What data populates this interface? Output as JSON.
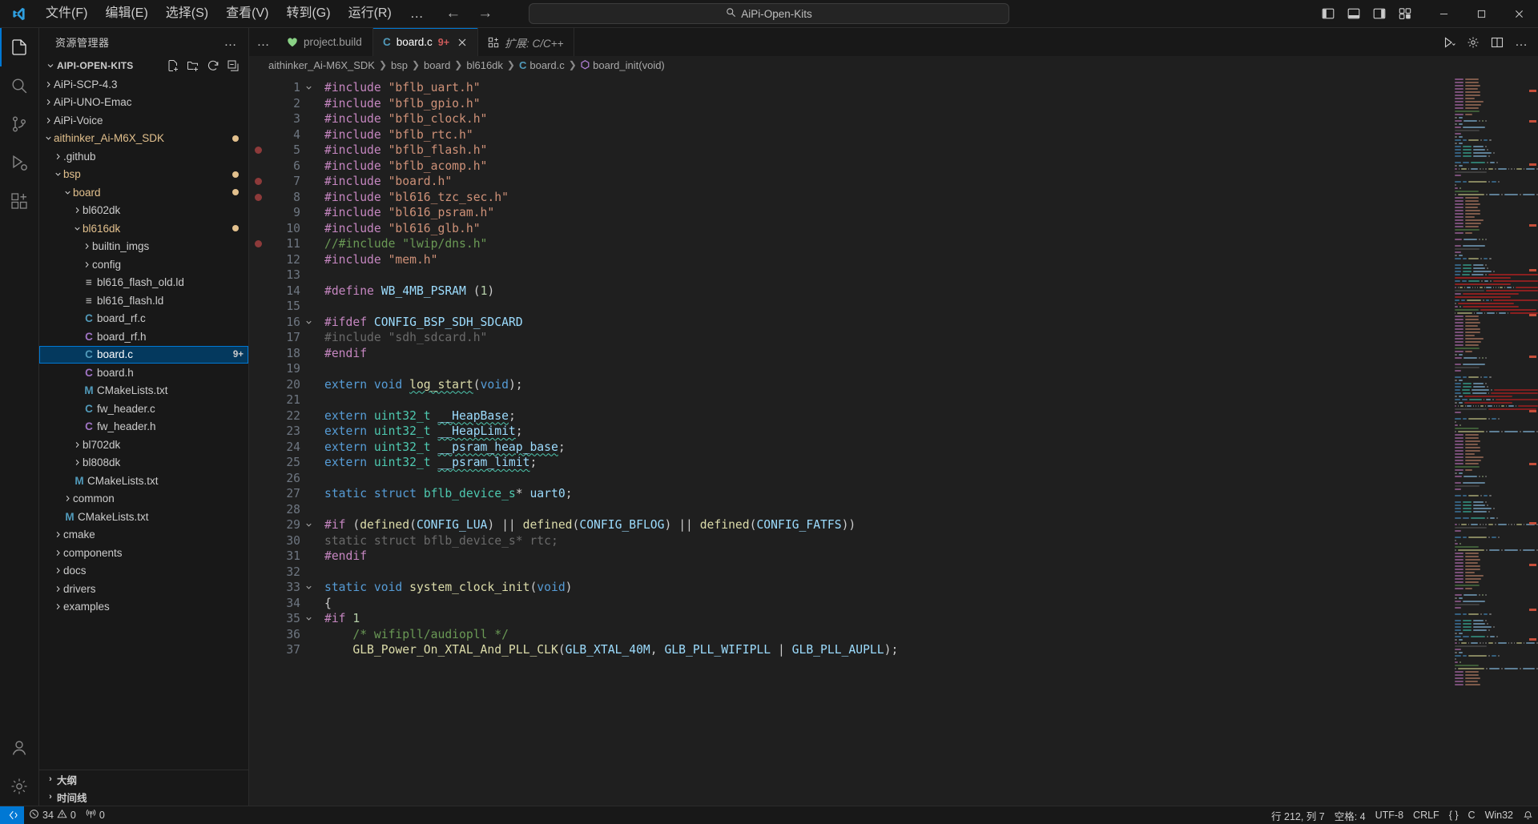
{
  "titlebar": {
    "menu": [
      "文件(F)",
      "编辑(E)",
      "选择(S)",
      "查看(V)",
      "转到(G)",
      "运行(R)"
    ],
    "more_label": "…",
    "back_label": "←",
    "forward_label": "→",
    "search_value": "AiPi-Open-Kits"
  },
  "sidebar": {
    "header_title": "资源管理器",
    "more_label": "…",
    "root_label": "AIPI-OPEN-KITS",
    "sections": [
      "大纲",
      "时间线"
    ],
    "tree": [
      {
        "name": "AiPi-SCP-4.3",
        "indent": 1,
        "type": "folder",
        "expanded": false,
        "modified": false
      },
      {
        "name": "AiPi-UNO-Emac",
        "indent": 1,
        "type": "folder",
        "expanded": false,
        "modified": false
      },
      {
        "name": "AiPi-Voice",
        "indent": 1,
        "type": "folder",
        "expanded": false,
        "modified": false
      },
      {
        "name": "aithinker_Ai-M6X_SDK",
        "indent": 1,
        "type": "folder",
        "expanded": true,
        "modified": true
      },
      {
        "name": ".github",
        "indent": 2,
        "type": "folder",
        "expanded": false,
        "modified": false
      },
      {
        "name": "bsp",
        "indent": 2,
        "type": "folder",
        "expanded": true,
        "modified": true
      },
      {
        "name": "board",
        "indent": 3,
        "type": "folder",
        "expanded": true,
        "modified": true
      },
      {
        "name": "bl602dk",
        "indent": 4,
        "type": "folder",
        "expanded": false,
        "modified": false
      },
      {
        "name": "bl616dk",
        "indent": 4,
        "type": "folder",
        "expanded": true,
        "modified": true
      },
      {
        "name": "builtin_imgs",
        "indent": 5,
        "type": "folder",
        "expanded": false,
        "modified": false
      },
      {
        "name": "config",
        "indent": 5,
        "type": "folder",
        "expanded": false,
        "modified": false
      },
      {
        "name": "bl616_flash_old.ld",
        "indent": 5,
        "type": "ld",
        "icon": "≡",
        "color": "#cccccc"
      },
      {
        "name": "bl616_flash.ld",
        "indent": 5,
        "type": "ld",
        "icon": "≡",
        "color": "#cccccc"
      },
      {
        "name": "board_rf.c",
        "indent": 5,
        "type": "c",
        "icon": "C",
        "color": "#519aba"
      },
      {
        "name": "board_rf.h",
        "indent": 5,
        "type": "h",
        "icon": "C",
        "color": "#a074c4"
      },
      {
        "name": "board.c",
        "indent": 5,
        "type": "c",
        "icon": "C",
        "color": "#519aba",
        "selected": true,
        "badge": "9+"
      },
      {
        "name": "board.h",
        "indent": 5,
        "type": "h",
        "icon": "C",
        "color": "#a074c4"
      },
      {
        "name": "CMakeLists.txt",
        "indent": 5,
        "type": "cmake",
        "icon": "M",
        "color": "#519aba"
      },
      {
        "name": "fw_header.c",
        "indent": 5,
        "type": "c",
        "icon": "C",
        "color": "#519aba"
      },
      {
        "name": "fw_header.h",
        "indent": 5,
        "type": "h",
        "icon": "C",
        "color": "#a074c4"
      },
      {
        "name": "bl702dk",
        "indent": 4,
        "type": "folder",
        "expanded": false,
        "modified": false
      },
      {
        "name": "bl808dk",
        "indent": 4,
        "type": "folder",
        "expanded": false,
        "modified": false
      },
      {
        "name": "CMakeLists.txt",
        "indent": 4,
        "type": "cmake",
        "icon": "M",
        "color": "#519aba"
      },
      {
        "name": "common",
        "indent": 3,
        "type": "folder",
        "expanded": false,
        "modified": false
      },
      {
        "name": "CMakeLists.txt",
        "indent": 3,
        "type": "cmake",
        "icon": "M",
        "color": "#519aba"
      },
      {
        "name": "cmake",
        "indent": 2,
        "type": "folder",
        "expanded": false,
        "modified": false
      },
      {
        "name": "components",
        "indent": 2,
        "type": "folder",
        "expanded": false,
        "modified": false
      },
      {
        "name": "docs",
        "indent": 2,
        "type": "folder",
        "expanded": false,
        "modified": false
      },
      {
        "name": "drivers",
        "indent": 2,
        "type": "folder",
        "expanded": false,
        "modified": false
      },
      {
        "name": "examples",
        "indent": 2,
        "type": "folder",
        "expanded": false,
        "modified": false
      }
    ]
  },
  "tabs": [
    {
      "label": "project.build",
      "icon": "heart",
      "icon_color": "#89d185",
      "active": false,
      "badge": "",
      "preview": false
    },
    {
      "label": "board.c",
      "icon": "C",
      "icon_color": "#519aba",
      "active": true,
      "badge": "9+",
      "preview": false,
      "closable": true
    },
    {
      "label": "扩展: C/C++",
      "icon": "extensions",
      "icon_color": "#cccccc",
      "active": false,
      "badge": "",
      "preview": true
    }
  ],
  "breadcrumb": [
    {
      "label": "aithinker_Ai-M6X_SDK"
    },
    {
      "label": "bsp"
    },
    {
      "label": "board"
    },
    {
      "label": "bl616dk"
    },
    {
      "label": "board.c",
      "icon": "C",
      "icon_color": "#519aba"
    },
    {
      "label": "board_init(void)",
      "icon": "symbol",
      "icon_color": "#b180d7"
    }
  ],
  "editor": {
    "first_line": 1,
    "lines": [
      {
        "n": 1,
        "fold": "v",
        "bp": false,
        "tokens": [
          [
            "#include ",
            "c-pre"
          ],
          [
            "\"bflb_uart.h\"",
            "c-str"
          ]
        ]
      },
      {
        "n": 2,
        "fold": "",
        "bp": false,
        "tokens": [
          [
            "#include ",
            "c-pre"
          ],
          [
            "\"bflb_gpio.h\"",
            "c-str"
          ]
        ]
      },
      {
        "n": 3,
        "fold": "",
        "bp": false,
        "tokens": [
          [
            "#include ",
            "c-pre"
          ],
          [
            "\"bflb_clock.h\"",
            "c-str"
          ]
        ]
      },
      {
        "n": 4,
        "fold": "",
        "bp": false,
        "tokens": [
          [
            "#include ",
            "c-pre"
          ],
          [
            "\"bflb_rtc.h\"",
            "c-str"
          ]
        ]
      },
      {
        "n": 5,
        "fold": "",
        "bp": true,
        "tokens": [
          [
            "#include ",
            "c-pre"
          ],
          [
            "\"bflb_flash.h\"",
            "c-str"
          ]
        ]
      },
      {
        "n": 6,
        "fold": "",
        "bp": false,
        "tokens": [
          [
            "#include ",
            "c-pre"
          ],
          [
            "\"bflb_acomp.h\"",
            "c-str"
          ]
        ]
      },
      {
        "n": 7,
        "fold": "",
        "bp": true,
        "tokens": [
          [
            "#include ",
            "c-pre"
          ],
          [
            "\"board.h\"",
            "c-str"
          ]
        ]
      },
      {
        "n": 8,
        "fold": "",
        "bp": true,
        "tokens": [
          [
            "#include ",
            "c-pre"
          ],
          [
            "\"bl616_tzc_sec.h\"",
            "c-str"
          ]
        ]
      },
      {
        "n": 9,
        "fold": "",
        "bp": false,
        "tokens": [
          [
            "#include ",
            "c-pre"
          ],
          [
            "\"bl616_psram.h\"",
            "c-str"
          ]
        ]
      },
      {
        "n": 10,
        "fold": "",
        "bp": false,
        "tokens": [
          [
            "#include ",
            "c-pre"
          ],
          [
            "\"bl616_glb.h\"",
            "c-str"
          ]
        ]
      },
      {
        "n": 11,
        "fold": "",
        "bp": true,
        "tokens": [
          [
            "//#include \"lwip/dns.h\"",
            "c-cmt"
          ]
        ]
      },
      {
        "n": 12,
        "fold": "",
        "bp": false,
        "tokens": [
          [
            "#include ",
            "c-pre"
          ],
          [
            "\"mem.h\"",
            "c-str"
          ]
        ]
      },
      {
        "n": 13,
        "fold": "",
        "bp": false,
        "tokens": []
      },
      {
        "n": 14,
        "fold": "",
        "bp": false,
        "tokens": [
          [
            "#define ",
            "c-pre"
          ],
          [
            "WB_4MB_PSRAM ",
            "c-var"
          ],
          [
            "(",
            "c-def"
          ],
          [
            "1",
            "c-num"
          ],
          [
            ")",
            "c-def"
          ]
        ]
      },
      {
        "n": 15,
        "fold": "",
        "bp": false,
        "tokens": []
      },
      {
        "n": 16,
        "fold": "v",
        "bp": false,
        "tokens": [
          [
            "#ifdef ",
            "c-pre"
          ],
          [
            "CONFIG_BSP_SDH_SDCARD",
            "c-var"
          ]
        ]
      },
      {
        "n": 17,
        "fold": "",
        "bp": false,
        "tokens": [
          [
            "#include \"sdh_sdcard.h\"",
            "c-dim"
          ]
        ]
      },
      {
        "n": 18,
        "fold": "",
        "bp": false,
        "tokens": [
          [
            "#endif",
            "c-pre"
          ]
        ]
      },
      {
        "n": 19,
        "fold": "",
        "bp": false,
        "tokens": []
      },
      {
        "n": 20,
        "fold": "",
        "bp": false,
        "tokens": [
          [
            "extern ",
            "c-kw"
          ],
          [
            "void ",
            "c-kw"
          ],
          [
            "log_start",
            "c-fn sq"
          ],
          [
            "(",
            "c-def"
          ],
          [
            "void",
            "c-kw"
          ],
          [
            ");",
            "c-def"
          ]
        ]
      },
      {
        "n": 21,
        "fold": "",
        "bp": false,
        "tokens": []
      },
      {
        "n": 22,
        "fold": "",
        "bp": false,
        "tokens": [
          [
            "extern ",
            "c-kw"
          ],
          [
            "uint32_t ",
            "c-typ"
          ],
          [
            "__HeapBase",
            "c-var sq"
          ],
          [
            ";",
            "c-def"
          ]
        ]
      },
      {
        "n": 23,
        "fold": "",
        "bp": false,
        "tokens": [
          [
            "extern ",
            "c-kw"
          ],
          [
            "uint32_t ",
            "c-typ"
          ],
          [
            "__HeapLimit",
            "c-var sq"
          ],
          [
            ";",
            "c-def"
          ]
        ]
      },
      {
        "n": 24,
        "fold": "",
        "bp": false,
        "tokens": [
          [
            "extern ",
            "c-kw"
          ],
          [
            "uint32_t ",
            "c-typ"
          ],
          [
            "__psram_heap_base",
            "c-var sq"
          ],
          [
            ";",
            "c-def"
          ]
        ]
      },
      {
        "n": 25,
        "fold": "",
        "bp": false,
        "tokens": [
          [
            "extern ",
            "c-kw"
          ],
          [
            "uint32_t ",
            "c-typ"
          ],
          [
            "__psram_limit",
            "c-var sq"
          ],
          [
            ";",
            "c-def"
          ]
        ]
      },
      {
        "n": 26,
        "fold": "",
        "bp": false,
        "tokens": []
      },
      {
        "n": 27,
        "fold": "",
        "bp": false,
        "tokens": [
          [
            "static ",
            "c-kw"
          ],
          [
            "struct ",
            "c-kw"
          ],
          [
            "bflb_device_s",
            "c-typ"
          ],
          [
            "* ",
            "c-def"
          ],
          [
            "uart0",
            "c-var"
          ],
          [
            ";",
            "c-def"
          ]
        ]
      },
      {
        "n": 28,
        "fold": "",
        "bp": false,
        "tokens": []
      },
      {
        "n": 29,
        "fold": "v",
        "bp": false,
        "tokens": [
          [
            "#if ",
            "c-pre"
          ],
          [
            "(",
            "c-def"
          ],
          [
            "defined",
            "c-fn"
          ],
          [
            "(",
            "c-def"
          ],
          [
            "CONFIG_LUA",
            "c-var"
          ],
          [
            ") ",
            "c-def"
          ],
          [
            "||",
            "c-def"
          ],
          [
            " ",
            "c-def"
          ],
          [
            "defined",
            "c-fn"
          ],
          [
            "(",
            "c-def"
          ],
          [
            "CONFIG_BFLOG",
            "c-var"
          ],
          [
            ") ",
            "c-def"
          ],
          [
            "||",
            "c-def"
          ],
          [
            " ",
            "c-def"
          ],
          [
            "defined",
            "c-fn"
          ],
          [
            "(",
            "c-def"
          ],
          [
            "CONFIG_FATFS",
            "c-var"
          ],
          [
            "))",
            "c-def"
          ]
        ]
      },
      {
        "n": 30,
        "fold": "",
        "bp": false,
        "tokens": [
          [
            "static struct bflb_device_s* rtc;",
            "c-dim"
          ]
        ]
      },
      {
        "n": 31,
        "fold": "",
        "bp": false,
        "tokens": [
          [
            "#endif",
            "c-pre"
          ]
        ]
      },
      {
        "n": 32,
        "fold": "",
        "bp": false,
        "tokens": []
      },
      {
        "n": 33,
        "fold": "v",
        "bp": false,
        "tokens": [
          [
            "static ",
            "c-kw"
          ],
          [
            "void ",
            "c-kw"
          ],
          [
            "system_clock_init",
            "c-fn"
          ],
          [
            "(",
            "c-def"
          ],
          [
            "void",
            "c-kw"
          ],
          [
            ")",
            "c-def"
          ]
        ]
      },
      {
        "n": 34,
        "fold": "",
        "bp": false,
        "tokens": [
          [
            "{",
            "c-def"
          ]
        ]
      },
      {
        "n": 35,
        "fold": "v",
        "bp": false,
        "tokens": [
          [
            "#if ",
            "c-pre"
          ],
          [
            "1",
            "c-num"
          ]
        ]
      },
      {
        "n": 36,
        "fold": "",
        "bp": false,
        "tokens": [
          [
            "    /* wifipll/audiopll */",
            "c-cmt"
          ]
        ]
      },
      {
        "n": 37,
        "fold": "",
        "bp": false,
        "tokens": [
          [
            "    ",
            "c-def"
          ],
          [
            "GLB_Power_On_XTAL_And_PLL_CLK",
            "c-fn"
          ],
          [
            "(",
            "c-def"
          ],
          [
            "GLB_XTAL_40M",
            "c-var"
          ],
          [
            ", ",
            "c-def"
          ],
          [
            "GLB_PLL_WIFIPLL",
            "c-var"
          ],
          [
            " | ",
            "c-def"
          ],
          [
            "GLB_PLL_AUPLL",
            "c-var"
          ],
          [
            ");",
            "c-def"
          ]
        ]
      }
    ]
  },
  "statusbar": {
    "remote_label": "",
    "errors": "34",
    "warnings": "0",
    "ports": "0",
    "position": "行 212, 列 7",
    "indent": "空格: 4",
    "encoding": "UTF-8",
    "eol": "CRLF",
    "language": "C",
    "platform": "Win32",
    "brackets": "{ }"
  }
}
